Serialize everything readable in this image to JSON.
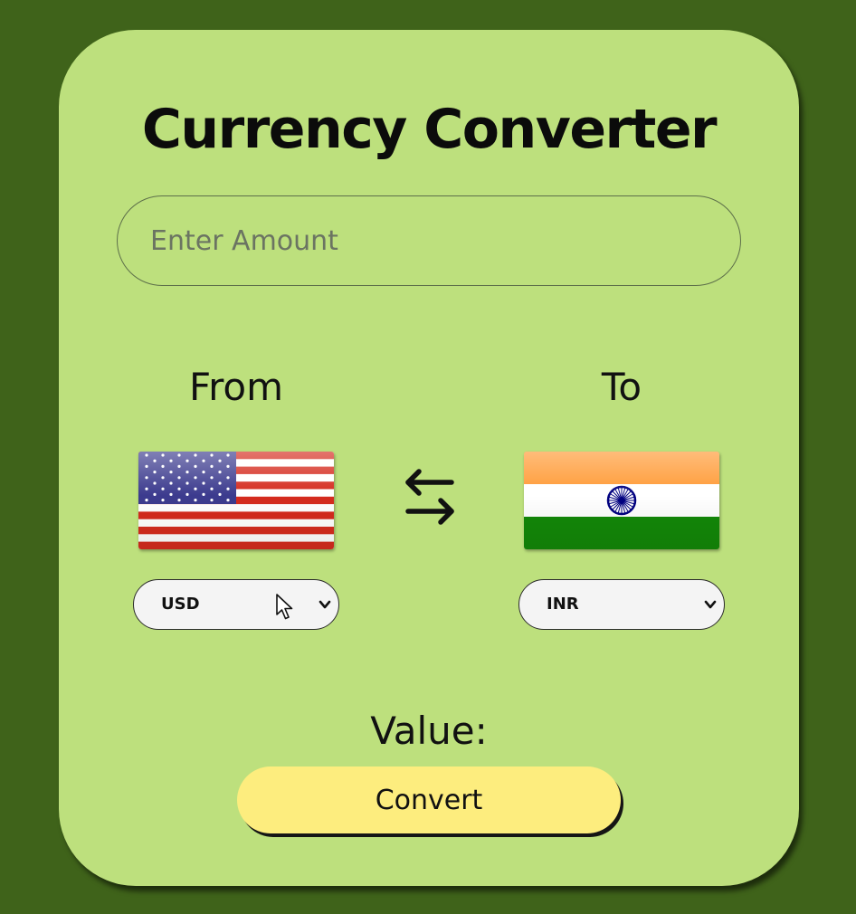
{
  "title": "Currency Converter",
  "amount_input": {
    "placeholder": "Enter Amount",
    "value": ""
  },
  "from": {
    "label": "From",
    "flag": "us-flag",
    "selected_currency": "USD"
  },
  "to": {
    "label": "To",
    "flag": "india-flag",
    "selected_currency": "INR"
  },
  "swap": {
    "icon": "swap-arrows-icon"
  },
  "result": {
    "label": "Value:",
    "value": ""
  },
  "convert_button": {
    "label": "Convert"
  },
  "colors": {
    "background": "#3f631a",
    "card": "#bde07d",
    "button": "#fded7e",
    "text": "#111111"
  }
}
